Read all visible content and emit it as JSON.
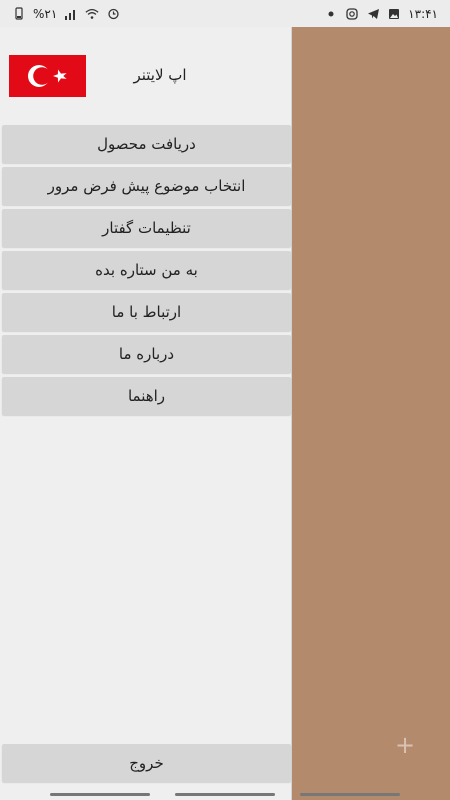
{
  "status_bar": {
    "battery_text": "%۲۱",
    "time": "۱۳:۴۱",
    "left_icons": [
      "battery-icon",
      "signal-icon",
      "wifi-icon",
      "alarm-icon"
    ],
    "right_icons": [
      "dot-icon",
      "instagram-icon",
      "telegram-icon",
      "gallery-icon"
    ]
  },
  "drawer": {
    "app_title": "اپ لایتنر",
    "flag_icon": "turkey-flag-icon",
    "menu": [
      "دریافت محصول",
      "انتخاب موضوع پیش فرض مرور",
      "تنظیمات گفتار",
      "به من ستاره بده",
      "ارتباط با ما",
      "درباره ما",
      "راهنما"
    ],
    "exit_label": "خروج"
  },
  "fab": {
    "icon": "plus-icon",
    "symbol": "+"
  },
  "colors": {
    "background": "#b38a6c",
    "drawer": "#efefef",
    "button": "#d6d6d6",
    "flag_red": "#e30a17"
  }
}
